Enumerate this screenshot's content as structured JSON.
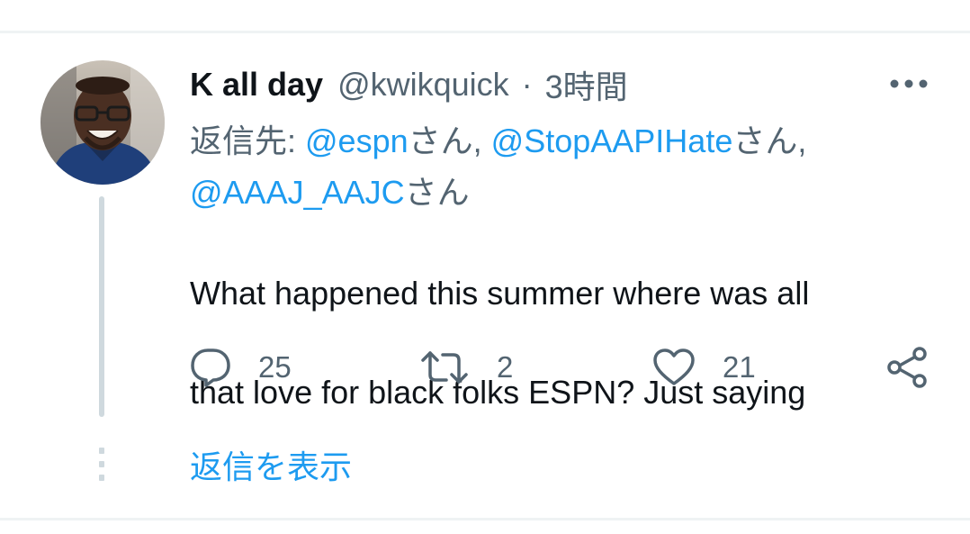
{
  "tweet": {
    "display_name": "K all day",
    "handle": "@kwikquick",
    "separator": "·",
    "time": "3時間",
    "reply_prefix": "返信先: ",
    "mentions": [
      "@espn",
      "@StopAAPIHate",
      "@AAAJ_AAJC"
    ],
    "honorific": "さん",
    "mention_separator": ", ",
    "text_line1": "What happened this summer where was all",
    "text_line2": "that love for black folks ESPN? Just saying",
    "actions": {
      "reply_count": "25",
      "retweet_count": "2",
      "like_count": "21"
    },
    "show_replies": "返信を表示"
  },
  "icons": {
    "more": "more-horizontal-icon",
    "reply": "reply-bubble-icon",
    "retweet": "retweet-icon",
    "like": "heart-icon",
    "share": "share-icon"
  },
  "colors": {
    "accent": "#1d9bf0",
    "secondary_text": "#536471",
    "primary_text": "#0f1419",
    "divider": "#eff3f4",
    "thread_line": "#cfd9de"
  }
}
